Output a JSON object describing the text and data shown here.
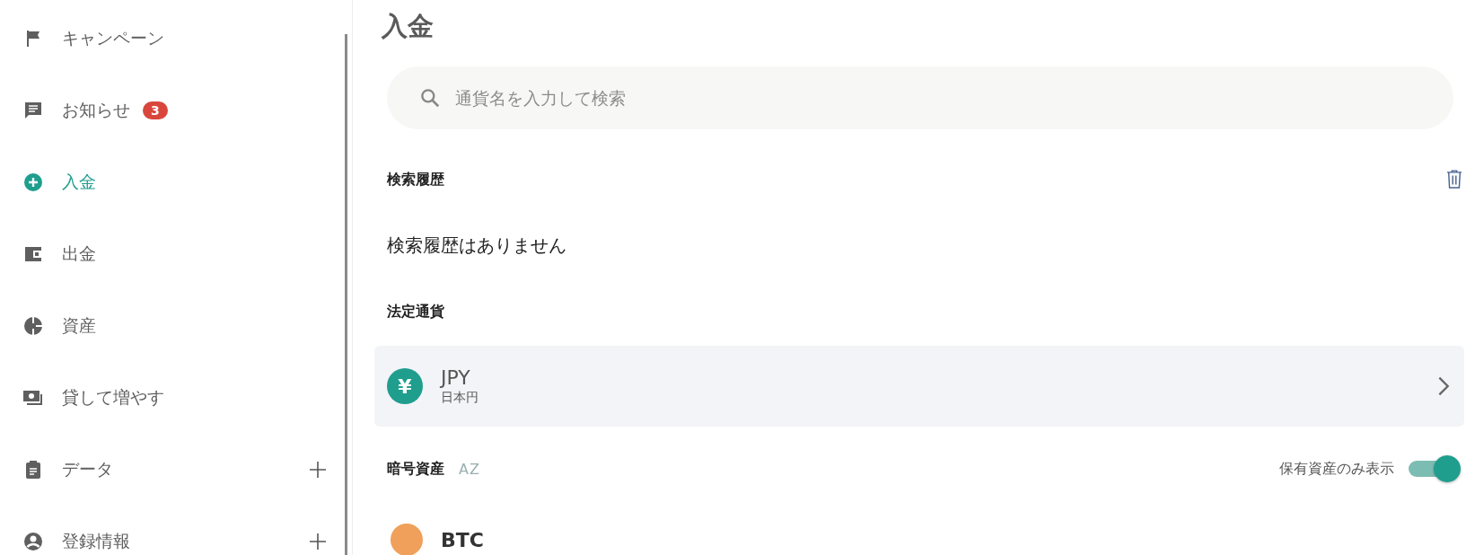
{
  "sidebar": {
    "items": [
      {
        "label": "キャンペーン",
        "selected": false
      },
      {
        "label": "お知らせ",
        "selected": false,
        "badge": "3"
      },
      {
        "label": "入金",
        "selected": true
      },
      {
        "label": "出金",
        "selected": false
      },
      {
        "label": "資産",
        "selected": false
      },
      {
        "label": "貸して増やす",
        "selected": false
      },
      {
        "label": "データ",
        "selected": false,
        "expanded": false
      },
      {
        "label": "登録情報",
        "selected": false,
        "expanded": false
      }
    ]
  },
  "page_title": "入金",
  "search": {
    "placeholder": "通貨名を入力して検索"
  },
  "history": {
    "heading": "検索履歴",
    "empty_text": "検索履歴はありません"
  },
  "fiat": {
    "heading": "法定通貨",
    "items": [
      {
        "code": "JPY",
        "name": "日本円",
        "symbol": "¥"
      }
    ]
  },
  "crypto": {
    "heading": "暗号資産",
    "sort_icon_text": "AZ",
    "filter": {
      "label": "保有資産のみ表示",
      "on": true
    },
    "items": [
      {
        "code": "BTC"
      }
    ]
  }
}
